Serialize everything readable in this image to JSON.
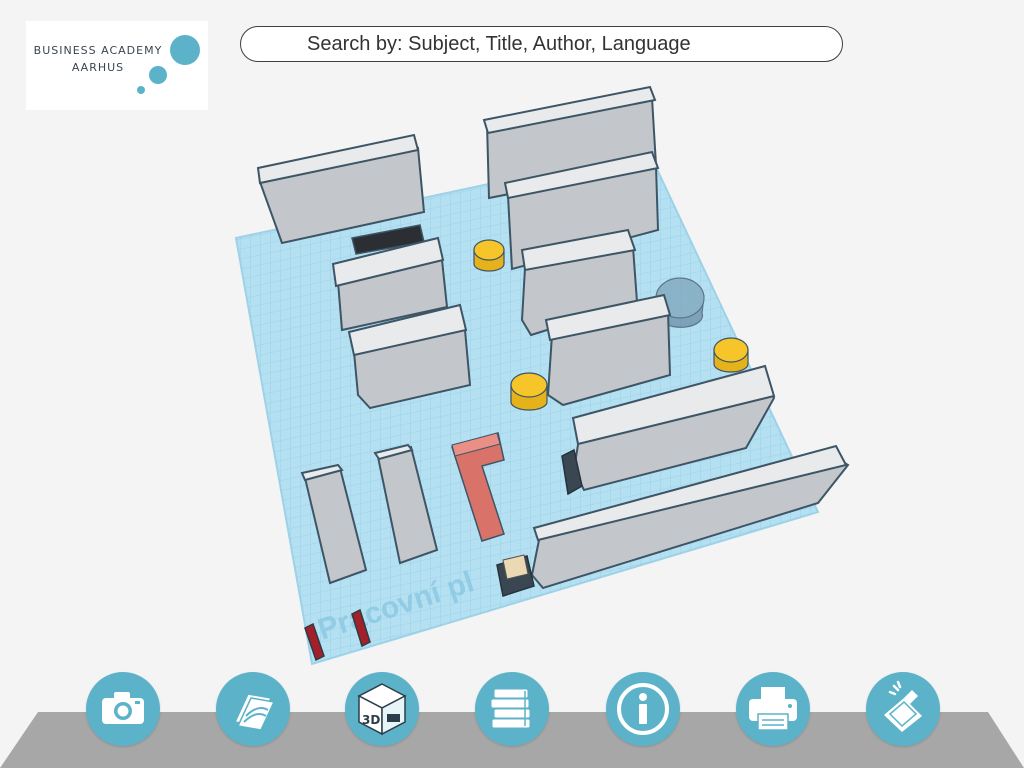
{
  "header": {
    "logo": {
      "line1": "BUSINESS ACADEMY",
      "line2": "AARHUS"
    },
    "search": {
      "placeholder": "Search by: Subject, Title, Author, Language"
    }
  },
  "floor_plan": {
    "watermark": "Pracovní pl"
  },
  "colors": {
    "accent": "#5cb3c9",
    "workplane": "#b4e0f2",
    "shelf": "#d3d6d9",
    "table_yellow": "#f5c52a",
    "desk_red": "#e08379",
    "toolbar_base": "#a7a7a7"
  },
  "toolbar": {
    "buttons": [
      {
        "icon": "camera-icon"
      },
      {
        "icon": "brochure-icon"
      },
      {
        "icon": "3d-box-icon"
      },
      {
        "icon": "books-icon"
      },
      {
        "icon": "info-icon"
      },
      {
        "icon": "printer-icon"
      },
      {
        "icon": "book-scanner-icon"
      }
    ]
  }
}
